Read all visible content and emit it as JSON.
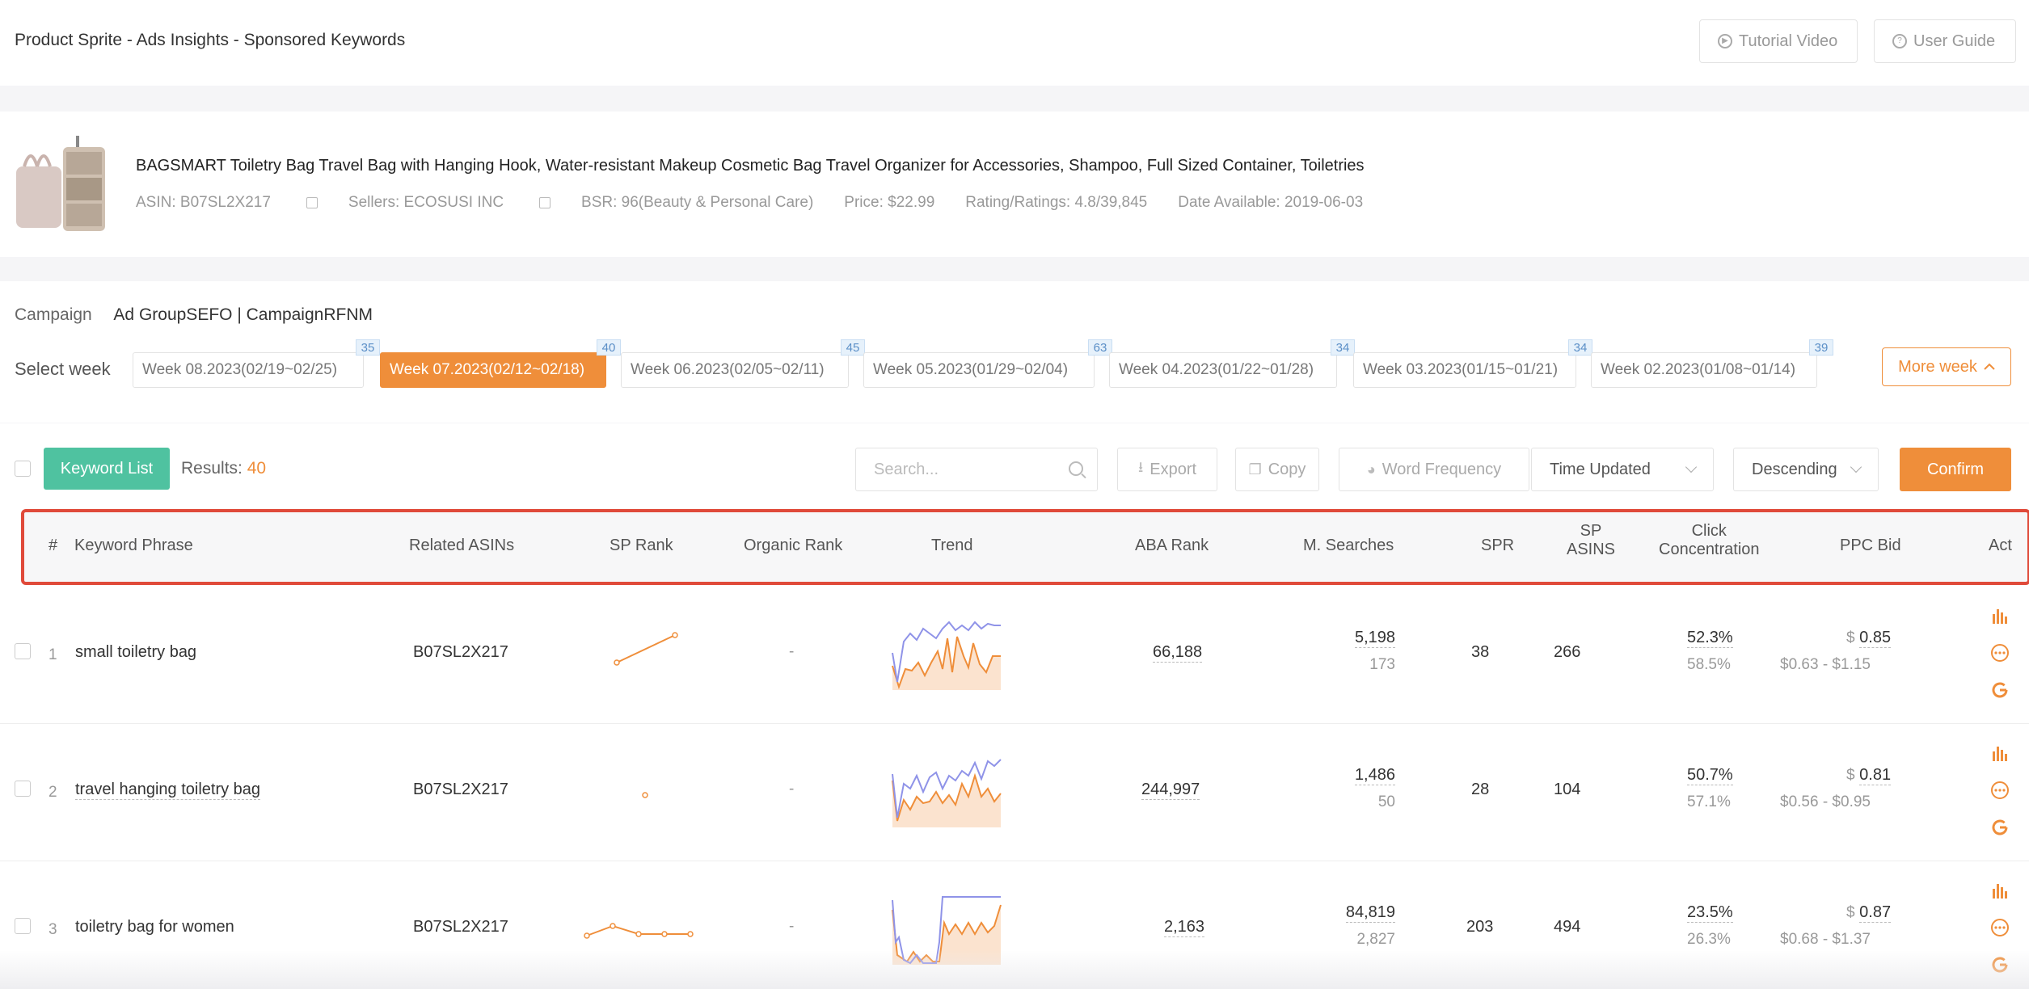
{
  "header": {
    "title": "Product Sprite - Ads Insights - Sponsored Keywords",
    "tutorial_label": "Tutorial Video",
    "guide_label": "User Guide"
  },
  "product": {
    "title": "BAGSMART Toiletry Bag Travel Bag with Hanging Hook, Water-resistant Makeup Cosmetic Bag Travel Organizer for Accessories, Shampoo, Full Sized Container, Toiletries",
    "asin": "ASIN: B07SL2X217",
    "sellers": "Sellers: ECOSUSI INC",
    "bsr": "BSR: 96(Beauty & Personal Care)",
    "price": "Price: $22.99",
    "rating": "Rating/Ratings: 4.8/39,845",
    "date": "Date Available: 2019-06-03"
  },
  "campaign": {
    "label": "Campaign",
    "value": "Ad GroupSEFO | CampaignRFNM"
  },
  "weeks": {
    "label": "Select week",
    "items": [
      {
        "label": "Week 08.2023(02/19~02/25)",
        "count": "35"
      },
      {
        "label": "Week 07.2023(02/12~02/18)",
        "count": "40",
        "active": true
      },
      {
        "label": "Week 06.2023(02/05~02/11)",
        "count": "45"
      },
      {
        "label": "Week 05.2023(01/29~02/04)",
        "count": "63"
      },
      {
        "label": "Week 04.2023(01/22~01/28)",
        "count": "34"
      },
      {
        "label": "Week 03.2023(01/15~01/21)",
        "count": "34"
      },
      {
        "label": "Week 02.2023(01/08~01/14)",
        "count": "39"
      }
    ],
    "more_label": "More week"
  },
  "toolbar": {
    "keyword_list_label": "Keyword List",
    "results_label": "Results:",
    "results_count": "40",
    "search_placeholder": "Search...",
    "export_label": "Export",
    "copy_label": "Copy",
    "word_freq_label": "Word Frequency",
    "sort_field": "Time Updated",
    "sort_order": "Descending",
    "confirm_label": "Confirm"
  },
  "table": {
    "headers": {
      "num": "#",
      "keyword": "Keyword Phrase",
      "asins": "Related ASINs",
      "sp_rank": "SP Rank",
      "organic": "Organic Rank",
      "trend": "Trend",
      "aba": "ABA Rank",
      "msearch": "M. Searches",
      "spr": "SPR",
      "sp_asins_1": "SP",
      "sp_asins_2": "ASINS",
      "click_1": "Click",
      "click_2": "Concentration",
      "ppc": "PPC Bid",
      "act": "Act"
    },
    "rows": [
      {
        "num": "1",
        "keyword": "small toiletry bag",
        "asin": "B07SL2X217",
        "organic": "-",
        "aba": "66,188",
        "msearch": "5,198",
        "msearch_sub": "173",
        "spr": "38",
        "sp_asins": "266",
        "click": "52.3%",
        "click_sub": "58.5%",
        "ppc_cur": "$",
        "ppc": "0.85",
        "ppc_range": "$0.63 - $1.15"
      },
      {
        "num": "2",
        "keyword": "travel hanging toiletry bag",
        "asin": "B07SL2X217",
        "organic": "-",
        "aba": "244,997",
        "msearch": "1,486",
        "msearch_sub": "50",
        "spr": "28",
        "sp_asins": "104",
        "click": "50.7%",
        "click_sub": "57.1%",
        "ppc_cur": "$",
        "ppc": "0.81",
        "ppc_range": "$0.56 - $0.95"
      },
      {
        "num": "3",
        "keyword": "toiletry bag for women",
        "asin": "B07SL2X217",
        "organic": "-",
        "aba": "2,163",
        "msearch": "84,819",
        "msearch_sub": "2,827",
        "spr": "203",
        "sp_asins": "494",
        "click": "23.5%",
        "click_sub": "26.3%",
        "ppc_cur": "$",
        "ppc": "0.87",
        "ppc_range": "$0.68 - $1.37"
      }
    ]
  },
  "colors": {
    "accent": "#ef8e3a",
    "green": "#4fc2a0",
    "highlight": "#e04a3a",
    "trend_blue": "#8f93e8"
  }
}
